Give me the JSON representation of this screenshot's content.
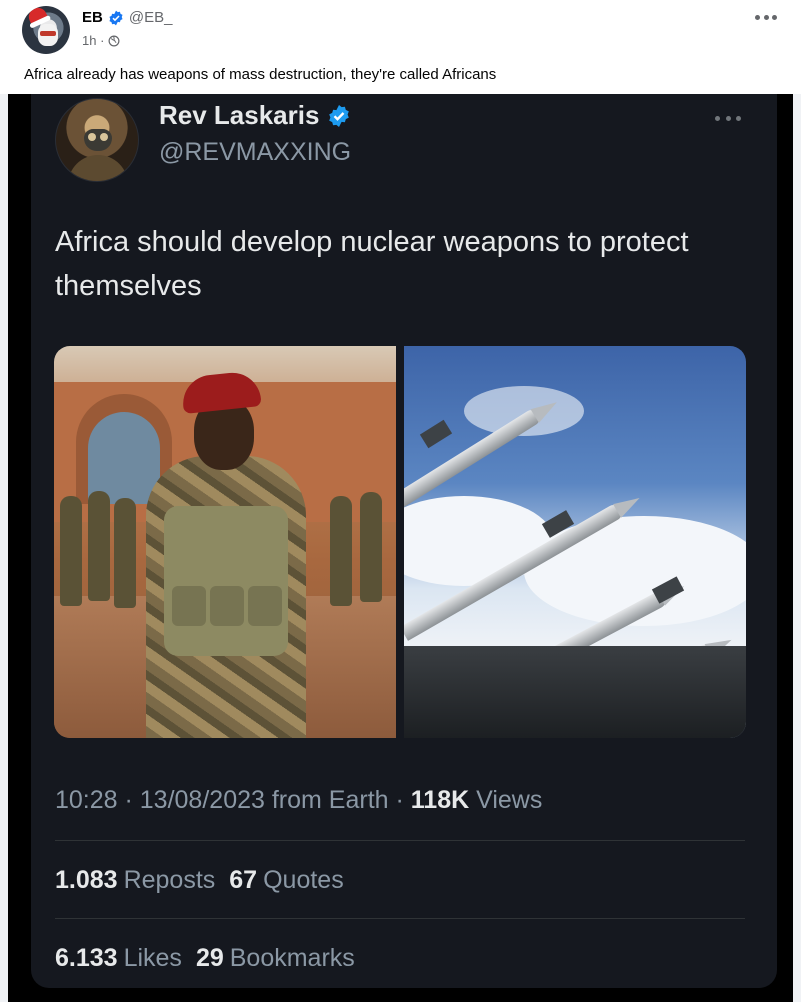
{
  "post": {
    "author_name": "EB",
    "author_handle": "@EB_",
    "time": "1h ·",
    "text": "Africa already has weapons of mass destruction, they're called Africans",
    "verified_badge_color": "#1877f2",
    "more_icon": "more-horizontal-icon",
    "audience_icon": "globe-icon"
  },
  "tweet": {
    "name": "Rev Laskaris",
    "handle": "@REVMAXXING",
    "text": "Africa should develop nuclear weapons to protect themselves",
    "verified_badge_color": "#1d9bf0",
    "meta_prefix": "10:28 · 13/08/2023 from Earth · ",
    "views_count": "118K",
    "views_label": " Views",
    "reposts_count": "1.083",
    "reposts_label": "Reposts",
    "quotes_count": "67",
    "quotes_label": "Quotes",
    "likes_count": "6.133",
    "likes_label": "Likes",
    "bookmarks_count": "29",
    "bookmarks_label": "Bookmarks"
  }
}
